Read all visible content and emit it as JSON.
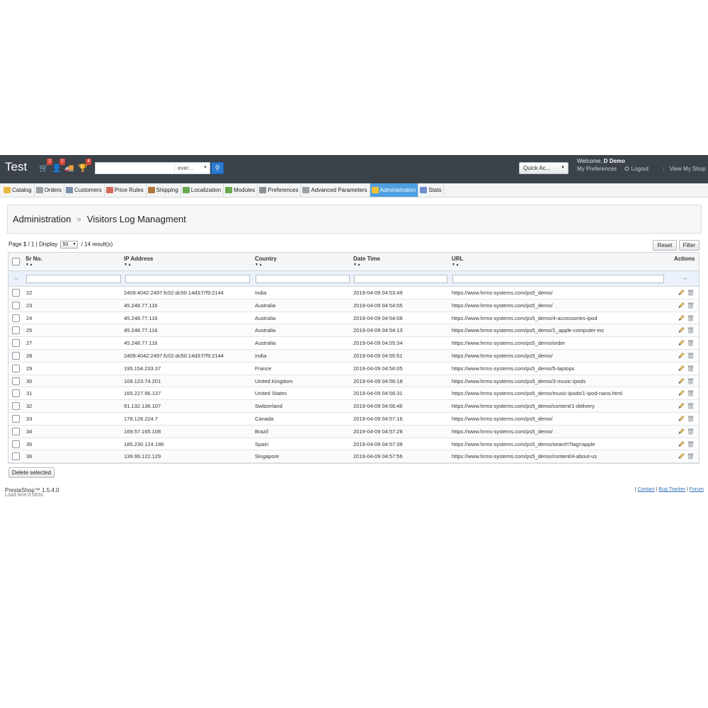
{
  "header": {
    "shop_name": "Test",
    "notifications": [
      {
        "icon": "cart-icon",
        "count": "1"
      },
      {
        "icon": "customer-icon",
        "count": "1"
      },
      {
        "icon": "truck-icon",
        "count": ""
      },
      {
        "icon": "trophy-icon",
        "count": "4"
      }
    ],
    "search": {
      "value": "",
      "placeholder": "",
      "scope": "ever..."
    },
    "quick_access": "Quick Ac...",
    "welcome_prefix": "Welcome, ",
    "employee_name": "D Demo",
    "my_preferences": "My Preferences",
    "logout": "Logout",
    "view_shop": "View My Shop"
  },
  "tabs": [
    {
      "label": "Catalog",
      "icon": "folder-icon",
      "color": "#e8b640"
    },
    {
      "label": "Orders",
      "icon": "cart-icon",
      "color": "#9aa0a6"
    },
    {
      "label": "Customers",
      "icon": "customer-icon",
      "color": "#7a8fb0"
    },
    {
      "label": "Price Rules",
      "icon": "price-tag-icon",
      "color": "#d46a5a"
    },
    {
      "label": "Shipping",
      "icon": "truck-icon",
      "color": "#b0763d"
    },
    {
      "label": "Localization",
      "icon": "globe-icon",
      "color": "#6aa84f"
    },
    {
      "label": "Modules",
      "icon": "puzzle-icon",
      "color": "#6aa84f"
    },
    {
      "label": "Preferences",
      "icon": "preferences-icon",
      "color": "#8a8f96"
    },
    {
      "label": "Advanced Parameters",
      "icon": "wrench-icon",
      "color": "#9aa0a6"
    },
    {
      "label": "Administration",
      "icon": "key-icon",
      "color": "#f1c232",
      "active": true
    },
    {
      "label": "Stats",
      "icon": "stats-icon",
      "color": "#6d8fd0"
    }
  ],
  "breadcrumb": {
    "parent": "Administration",
    "current": "Visitors Log Managment"
  },
  "pagination": {
    "prefix": "Page ",
    "page": "1",
    "total_pages": " / 1",
    "display_label": " | Display ",
    "page_size": "50",
    "results": " / 14 result(s)"
  },
  "buttons": {
    "reset": "Reset",
    "filter": "Filter",
    "delete_selected": "Delete selected"
  },
  "table": {
    "columns": [
      "Sr No.",
      "IP Address",
      "Country",
      "Date Time",
      "URL",
      "Actions"
    ],
    "sort_glyph": "▼▲",
    "filter_dash": "--",
    "rows": [
      {
        "sr": "22",
        "ip": "2409:4042:2497:fc02:dc50:14d3:f7f9:2144",
        "country": "India",
        "datetime": "2019-04-09 04:53:49",
        "url": "https://www.hrms-systems.com/ps5_demo/"
      },
      {
        "sr": "23",
        "ip": "45.248.77.116",
        "country": "Australia",
        "datetime": "2019-04-09 04:54:05",
        "url": "https://www.hrms-systems.com/ps5_demo/"
      },
      {
        "sr": "24",
        "ip": "45.248.77.116",
        "country": "Australia",
        "datetime": "2019-04-09 04:54:08",
        "url": "https://www.hrms-systems.com/ps5_demo/4-accessories-ipod"
      },
      {
        "sr": "25",
        "ip": "45.248.77.116",
        "country": "Australia",
        "datetime": "2019-04-09 04:54:13",
        "url": "https://www.hrms-systems.com/ps5_demo/1_apple-computer-inc"
      },
      {
        "sr": "27",
        "ip": "45.248.77.116",
        "country": "Australia",
        "datetime": "2019-04-09 04:55:34",
        "url": "https://www.hrms-systems.com/ps5_demo/order"
      },
      {
        "sr": "28",
        "ip": "2409:4042:2497:fc02:dc50:14d3:f7f9:2144",
        "country": "India",
        "datetime": "2019-04-09 04:55:51",
        "url": "https://www.hrms-systems.com/ps5_demo/"
      },
      {
        "sr": "29",
        "ip": "195.154.233.37",
        "country": "France",
        "datetime": "2019-04-09 04:56:05",
        "url": "https://www.hrms-systems.com/ps5_demo/5-laptops"
      },
      {
        "sr": "30",
        "ip": "109.123.74.201",
        "country": "United Kingdom",
        "datetime": "2019-04-09 04:56:18",
        "url": "https://www.hrms-systems.com/ps5_demo/3-music-ipods"
      },
      {
        "sr": "31",
        "ip": "165.227.96.137",
        "country": "United States",
        "datetime": "2019-04-09 04:56:31",
        "url": "https://www.hrms-systems.com/ps5_demo/music-ipods/1-ipod-nano.html"
      },
      {
        "sr": "32",
        "ip": "91.132.136.107",
        "country": "Switzerland",
        "datetime": "2019-04-09 04:56:46",
        "url": "https://www.hrms-systems.com/ps5_demo/content/1-delivery"
      },
      {
        "sr": "33",
        "ip": "178.128.224.7",
        "country": "Canada",
        "datetime": "2019-04-09 04:57:16",
        "url": "https://www.hrms-systems.com/ps5_demo/"
      },
      {
        "sr": "34",
        "ip": "169.57.165.108",
        "country": "Brazil",
        "datetime": "2019-04-09 04:57:28",
        "url": "https://www.hrms-systems.com/ps5_demo/"
      },
      {
        "sr": "35",
        "ip": "185.230.124.186",
        "country": "Spain",
        "datetime": "2019-04-09 04:57:38",
        "url": "https://www.hrms-systems.com/ps5_demo/search?tag=apple"
      },
      {
        "sr": "36",
        "ip": "139.99.122.129",
        "country": "Singapore",
        "datetime": "2019-04-09 04:57:56",
        "url": "https://www.hrms-systems.com/ps5_demo/content/4-about-us"
      }
    ]
  },
  "footer": {
    "version": "PrestaShop™ 1.5.4.0",
    "load_time": "Load time:0.083s",
    "links": [
      "Contact",
      "Bug Tracker",
      "Forum"
    ]
  },
  "colors": {
    "header_bg": "#3b424a",
    "active_tab": "#4d9fe0",
    "search_button": "#2b7bd0",
    "badge": "#d64a3b"
  }
}
